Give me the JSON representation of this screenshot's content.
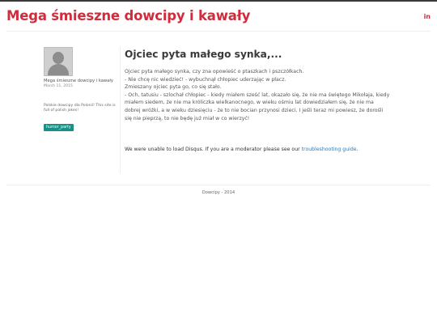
{
  "header": {
    "site_title": "Mega śmieszne dowcipy i kawały",
    "social_label": "in"
  },
  "sidebar": {
    "author": "Mega śmieszne dowcipy i kawały",
    "date": "March 11, 2015",
    "bio": "Polskie dowcipy dla Polonii! This site is full of polish jokes!",
    "tag": "humor_party"
  },
  "post": {
    "title": "Ojciec pyta małego synka,...",
    "lines": [
      "Ojciec pyta małego synka, czy zna opowieść o ptaszkach i pszczółkach.",
      "- Nie chcę nic wiedzieć! - wybuchnął chłopiec uderzając w płacz.",
      "Zmieszany ojciec pyta go, co się stało.",
      "- Och, tatusiu - szlochał chłopiec - kiedy miałem sześć lat, okazało się, że nie ma świętego Mikołaja, kiedy",
      "miałem siedem, że nie ma króliczka wielkanocnego, w wieku ośmiu lat dowiedziałem się, że nie ma",
      "dobrej wróżki, a w wieku dziesięciu - że to nie bocian przynosi dzieci. I jeśli teraz mi powiesz, że dorośli",
      "się nie pieprzą, to nie będę już miał w co wierzyć!"
    ]
  },
  "disqus": {
    "message": "We were unable to load Disqus. If you are a moderator please see our ",
    "link": "troubleshooting guide",
    "suffix": "."
  },
  "footer": {
    "text": "Dowcipy - 2014"
  },
  "colors": {
    "brand": "#cf2c3c",
    "tag_bg": "#1b8f86",
    "link": "#2a7ab8"
  }
}
